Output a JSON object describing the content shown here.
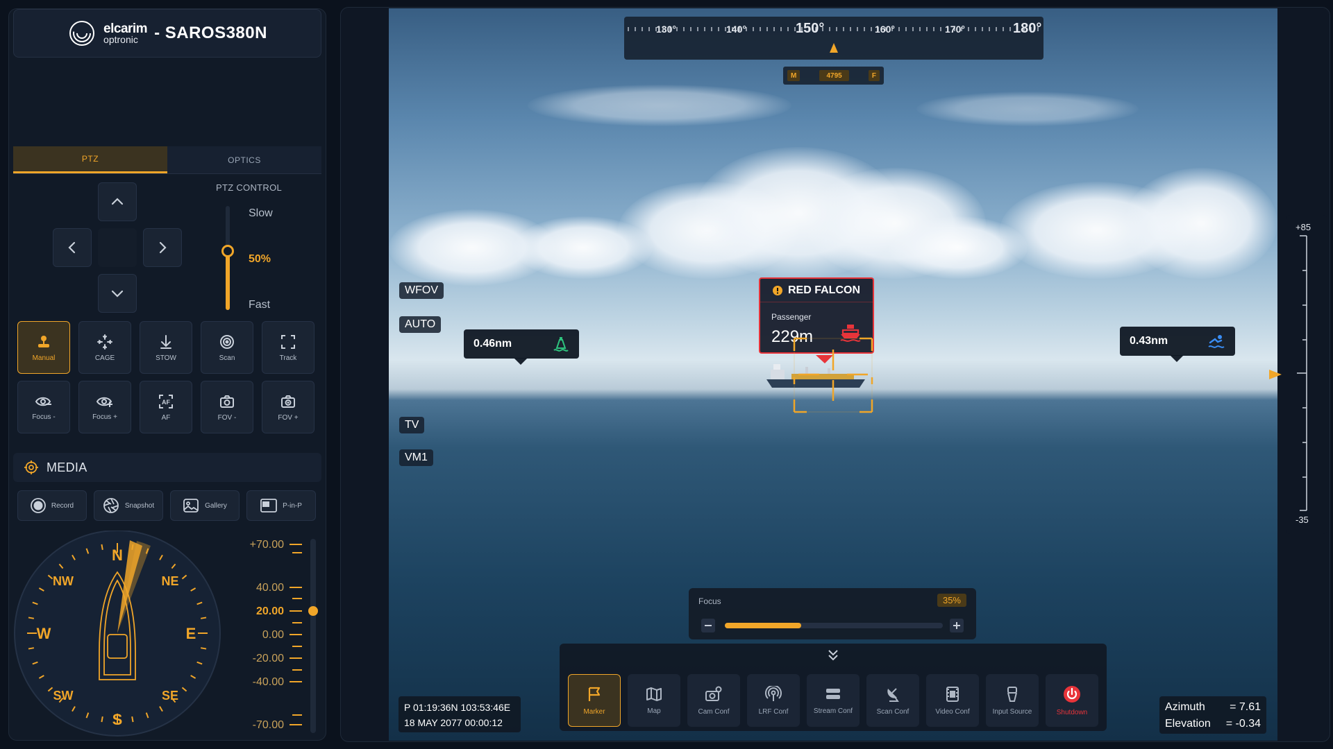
{
  "brand": {
    "logo_line1": "elcarim",
    "logo_line2": "optronic",
    "model": "- SAROS380N"
  },
  "tabs": [
    {
      "label": "PTZ",
      "active": true
    },
    {
      "label": "OPTICS",
      "active": false
    }
  ],
  "ptz": {
    "title": "PTZ CONTROL",
    "slow_label": "Slow",
    "fast_label": "Fast",
    "speed_value": "50%",
    "speed_fraction": 0.5
  },
  "tools_row1": [
    {
      "label": "Manual",
      "icon": "joystick-icon",
      "active": true
    },
    {
      "label": "CAGE",
      "icon": "cage-icon"
    },
    {
      "label": "STOW",
      "icon": "stow-down-arrow-icon"
    },
    {
      "label": "Scan",
      "icon": "scan-icon"
    },
    {
      "label": "Track",
      "icon": "track-frame-icon"
    }
  ],
  "tools_row2": [
    {
      "label": "Focus -",
      "icon": "focus-minus-icon"
    },
    {
      "label": "Focus +",
      "icon": "focus-plus-icon"
    },
    {
      "label": "AF",
      "icon": "autofocus-icon"
    },
    {
      "label": "FOV -",
      "icon": "fov-minus-icon"
    },
    {
      "label": "FOV +",
      "icon": "fov-plus-icon"
    }
  ],
  "media": {
    "title": "MEDIA",
    "buttons": [
      {
        "label": "Record",
        "icon": "record-icon"
      },
      {
        "label": "Snapshot",
        "icon": "aperture-icon"
      },
      {
        "label": "Gallery",
        "icon": "gallery-icon"
      },
      {
        "label": "P-in-P",
        "icon": "picture-in-picture-icon"
      }
    ]
  },
  "compass": {
    "n": "N",
    "ne": "NE",
    "e": "E",
    "se": "SE",
    "s": "S",
    "sw": "SW",
    "w": "W",
    "nw": "NW"
  },
  "pitch_scale": {
    "labels": [
      "+70.00",
      "40.00",
      "20.00",
      "0.00",
      "-20.00",
      "-40.00",
      "-70.00"
    ],
    "current": "20.00"
  },
  "heading": {
    "labels": [
      "130°",
      "140°",
      "150°",
      "160°",
      "170°",
      "180°"
    ],
    "current": "150°"
  },
  "mode_bar": {
    "left": "M",
    "value": "4795",
    "right": "F"
  },
  "overlay_tags": {
    "wfov": "WFOV",
    "auto": "AUTO",
    "tv": "TV",
    "vm1": "VM1"
  },
  "range_left": {
    "value": "0.46nm",
    "icon": "buoy-icon",
    "icon_color": "#2ec27e"
  },
  "range_right": {
    "value": "0.43nm",
    "icon": "swimmer-icon",
    "icon_color": "#3a8ef6"
  },
  "target": {
    "name": "RED FALCON",
    "type": "Passenger",
    "distance": "229m",
    "color": "#e8343a"
  },
  "focus": {
    "label": "Focus",
    "value": "35%",
    "fraction": 0.35
  },
  "toolbar": [
    {
      "label": "Marker",
      "icon": "flag-icon",
      "active": true
    },
    {
      "label": "Map",
      "icon": "map-icon"
    },
    {
      "label": "Cam Conf",
      "icon": "camera-settings-icon"
    },
    {
      "label": "LRF Conf",
      "icon": "antenna-icon"
    },
    {
      "label": "Stream Conf",
      "icon": "stream-icon"
    },
    {
      "label": "Scan Conf",
      "icon": "radar-dish-icon"
    },
    {
      "label": "Video Conf",
      "icon": "film-icon"
    },
    {
      "label": "Input Source",
      "icon": "input-source-icon"
    },
    {
      "label": "Shutdown",
      "icon": "power-icon",
      "danger": true
    }
  ],
  "position": {
    "coords": "P 01:19:36N 103:53:46E",
    "datetime": "18 MAY 2077 00:00:12"
  },
  "angles": {
    "azimuth_label": "Azimuth",
    "azimuth_value": "= 7.61",
    "elevation_label": "Elevation",
    "elevation_value": "= -0.34"
  },
  "elevation_scale": {
    "top": "+85",
    "bottom": "-35"
  },
  "colors": {
    "accent": "#f1a629",
    "danger": "#e8343a",
    "panel": "#111a27"
  }
}
